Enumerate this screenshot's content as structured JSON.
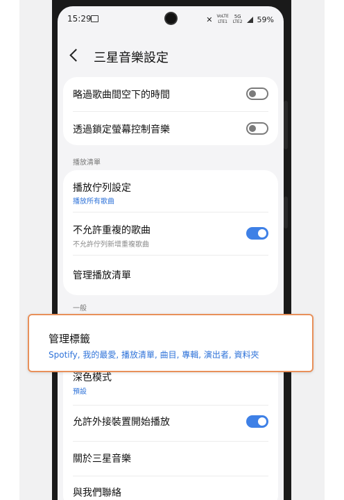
{
  "status": {
    "time": "15:29",
    "volte_top": "VoLTE",
    "volte_bottom": "LTE1",
    "net_top": "5G",
    "net_bottom": "LTE2",
    "battery": "59%"
  },
  "header": {
    "title": "三星音樂設定"
  },
  "settings_top": [
    {
      "label": "略過歌曲間空下的時間",
      "toggle": false
    },
    {
      "label": "透過鎖定螢幕控制音樂",
      "toggle": false
    }
  ],
  "playlist_section": {
    "header": "播放清單",
    "items": [
      {
        "label": "播放佇列設定",
        "sub": "播放所有歌曲"
      },
      {
        "label": "不允許重複的歌曲",
        "sub": "不允許佇列新增重複歌曲",
        "toggle": true
      },
      {
        "label": "管理播放清單"
      }
    ]
  },
  "general_section": {
    "header": "一般",
    "items": [
      {
        "label": "深色模式",
        "sub": "預設"
      },
      {
        "label": "允許外接裝置開始播放",
        "toggle": true
      },
      {
        "label": "關於三星音樂"
      },
      {
        "label": "與我們聯絡"
      }
    ]
  },
  "callout": {
    "title": "管理標籤",
    "sub": "Spotify, 我的最愛, 播放清單, 曲目, 專輯, 演出者, 資料夾"
  },
  "colors": {
    "accent": "#3e80e6",
    "callout_border": "#e8905a",
    "link_text": "#2f73d9"
  }
}
